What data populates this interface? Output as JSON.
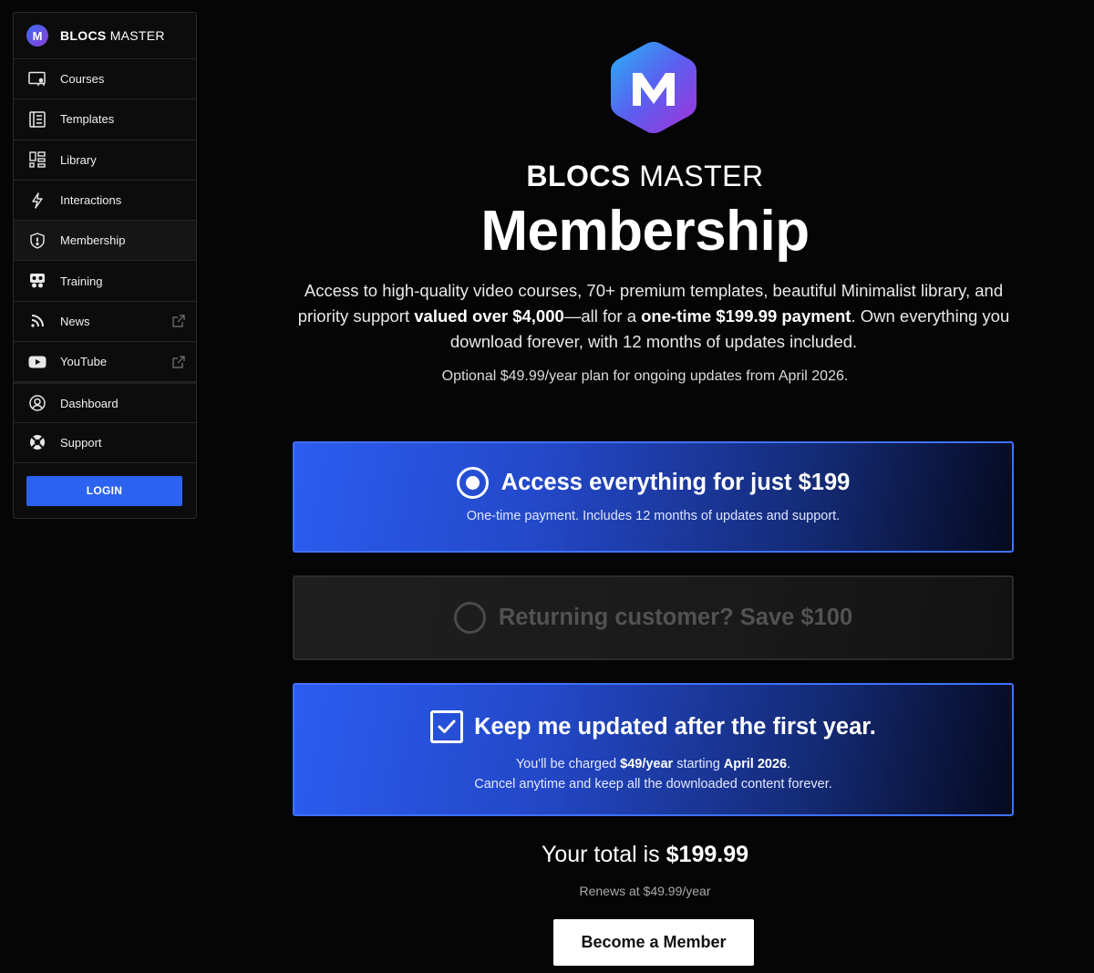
{
  "sidebar": {
    "brand": {
      "bold": "BLOCS",
      "rest": " MASTER",
      "logo_letter": "M"
    },
    "items": [
      {
        "label": "Courses",
        "icon": "courses-icon",
        "external": false
      },
      {
        "label": "Templates",
        "icon": "templates-icon",
        "external": false
      },
      {
        "label": "Library",
        "icon": "library-icon",
        "external": false
      },
      {
        "label": "Interactions",
        "icon": "bolt-icon",
        "external": false
      },
      {
        "label": "Membership",
        "icon": "shield-icon",
        "external": false,
        "active": true
      },
      {
        "label": "Training",
        "icon": "training-icon",
        "external": false
      },
      {
        "label": "News",
        "icon": "rss-icon",
        "external": true
      },
      {
        "label": "YouTube",
        "icon": "youtube-icon",
        "external": true
      },
      {
        "label": "Dashboard",
        "icon": "user-circle-icon",
        "external": false
      },
      {
        "label": "Support",
        "icon": "lifebuoy-icon",
        "external": false
      }
    ],
    "login_label": "LOGIN"
  },
  "hero": {
    "brand_bold": "BLOCS",
    "brand_rest": " MASTER",
    "title": "Membership",
    "intro_1": "Access to high-quality video courses, 70+ premium templates, beautiful Minimalist library, and priority support ",
    "intro_bold_1": "valued over $4,000",
    "intro_2": "—all for a ",
    "intro_bold_2": "one-time $199.99 payment",
    "intro_3": ". Own everything you download forever, with 12 months of updates included.",
    "optional": "Optional $49.99/year plan for ongoing updates from April 2026."
  },
  "options": {
    "full": {
      "title": "Access everything for just $199",
      "subtitle": "One-time payment. Includes 12 months of updates and support.",
      "selected": true
    },
    "returning": {
      "title": "Returning customer? Save $100",
      "selected": false
    },
    "updates": {
      "title": "Keep me updated after the first year.",
      "line1_a": "You'll be charged ",
      "line1_b": "$49/year",
      "line1_c": " starting ",
      "line1_d": "April 2026",
      "line1_e": ".",
      "line2": "Cancel anytime and keep all the downloaded content forever.",
      "checked": true
    }
  },
  "summary": {
    "total_prefix": "Your total is ",
    "total_value": "$199.99",
    "renews": "Renews at $49.99/year",
    "cta": "Become a Member"
  },
  "colors": {
    "accent": "#2c62f0",
    "card_border": "#3f72ff",
    "background": "#050505"
  }
}
